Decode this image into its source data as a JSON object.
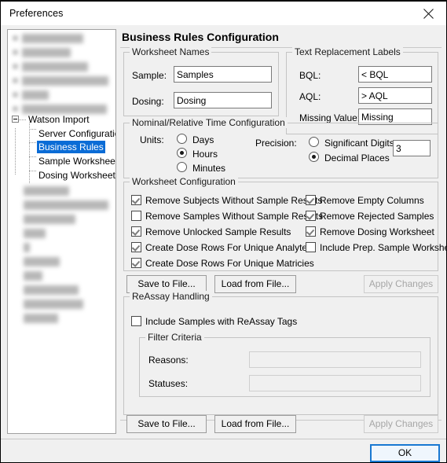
{
  "window": {
    "title": "Preferences",
    "close_icon": "close-icon"
  },
  "tree": {
    "items": [
      {
        "label": "Watson Import",
        "state": "expanded",
        "level": 0,
        "selected": false
      },
      {
        "label": "Server Configuration",
        "level": 1,
        "selected": false
      },
      {
        "label": "Business Rules",
        "level": 1,
        "selected": true
      },
      {
        "label": "Sample Worksheet C",
        "level": 1,
        "selected": false
      },
      {
        "label": "Dosing Worksheet C",
        "level": 1,
        "selected": false
      }
    ]
  },
  "main": {
    "page_title": "Business Rules Configuration",
    "worksheet_names": {
      "legend": "Worksheet Names",
      "sample_label": "Sample:",
      "sample_value": "Samples",
      "dosing_label": "Dosing:",
      "dosing_value": "Dosing"
    },
    "text_replacement": {
      "legend": "Text Replacement Labels",
      "bql_label": "BQL:",
      "bql_value": "< BQL",
      "aql_label": "AQL:",
      "aql_value": "> AQL",
      "missing_label": "Missing Value:",
      "missing_value": "Missing"
    },
    "time_config": {
      "legend": "Nominal/Relative Time Configuration",
      "units_label": "Units:",
      "units_options": [
        {
          "label": "Days",
          "selected": false
        },
        {
          "label": "Hours",
          "selected": true
        },
        {
          "label": "Minutes",
          "selected": false
        }
      ],
      "precision_label": "Precision:",
      "precision_options": [
        {
          "label": "Significant Digits",
          "selected": false
        },
        {
          "label": "Decimal Places",
          "selected": true
        }
      ],
      "precision_value": "3"
    },
    "worksheet_config": {
      "legend": "Worksheet Configuration",
      "left_column": [
        {
          "label": "Remove Subjects Without Sample Results",
          "checked": true
        },
        {
          "label": "Remove Samples Without Sample Results",
          "checked": false
        },
        {
          "label": "Remove Unlocked Sample Results",
          "checked": true
        },
        {
          "label": "Create Dose Rows For Unique Analytes",
          "checked": true
        },
        {
          "label": "Create Dose Rows For Unique Matricies",
          "checked": true
        }
      ],
      "right_column": [
        {
          "label": "Remove Empty Columns",
          "checked": true
        },
        {
          "label": "Remove Rejected Samples",
          "checked": true
        },
        {
          "label": "Remove Dosing Worksheet",
          "checked": true
        },
        {
          "label": "Include Prep. Sample Worksheet",
          "checked": false
        }
      ]
    },
    "config_actions": {
      "save_label": "Save to File...",
      "load_label": "Load from File...",
      "apply_label": "Apply Changes",
      "apply_enabled": false
    },
    "reassay": {
      "legend": "ReAssay Handling",
      "include_label": "Include Samples with ReAssay Tags",
      "include_checked": false,
      "filter_legend": "Filter Criteria",
      "reasons_label": "Reasons:",
      "reasons_value": "",
      "statuses_label": "Statuses:",
      "statuses_value": ""
    },
    "reassay_actions": {
      "save_label": "Save to File...",
      "load_label": "Load from File...",
      "apply_label": "Apply Changes",
      "apply_enabled": false
    }
  },
  "footer": {
    "ok_label": "OK"
  },
  "colors": {
    "selection_blue": "#0a6cd6",
    "default_button_border": "#1878d2",
    "dialog_bg": "#f0f0f0",
    "group_border": "#c4c4c4"
  }
}
